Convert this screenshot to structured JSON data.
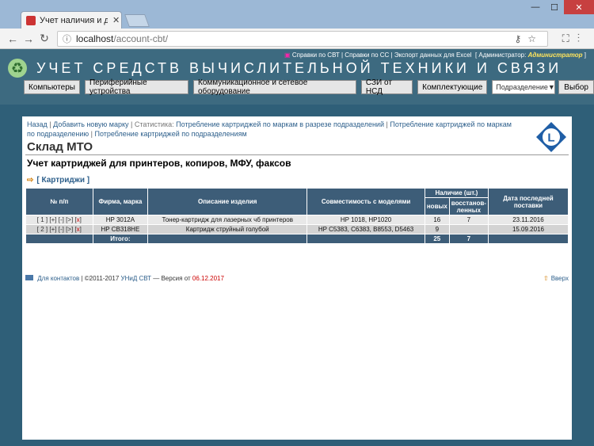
{
  "browser": {
    "tab_title": "Учет наличия и движен",
    "url_host": "localhost",
    "url_path": "/account-cbt/"
  },
  "header": {
    "links": [
      "Справки по СВТ",
      "Справки по СС",
      "Экспорт данных для Excel"
    ],
    "admin_label": "[ Администратор:",
    "admin_name": "Администратор",
    "admin_close": "]",
    "title": "УЧЕТ СРЕДСТВ ВЫЧИСЛИТЕЛЬНОЙ ТЕХНИКИ И СВЯЗИ"
  },
  "menu": {
    "items": [
      "Компьютеры",
      "Периферийные устройства",
      "Коммуникационное и сетевое оборудование",
      "СЗИ от НСД",
      "Комплектующие"
    ],
    "select_value": "Подразделение",
    "select_button": "Выбор"
  },
  "breadcrumb": {
    "back": "Назад",
    "add": "Добавить новую марку",
    "stats_label": "Статистика:",
    "stat1": "Потребление картриджей по маркам в разрезе подразделений",
    "stat2": "Потребление картриджей по маркам по подразделению",
    "stat3": "Потребление картриджей по подразделениям"
  },
  "page": {
    "title": "Склад МТО",
    "subtitle": "Учет картриджей для принтеров, копиров, МФУ, факсов",
    "section_link": "[ Картриджи ]"
  },
  "table": {
    "headers": {
      "num": "№ п/п",
      "brand": "Фирма, марка",
      "desc": "Описание изделия",
      "compat": "Совместимость с моделями",
      "stock": "Наличие (шт.)",
      "new": "новых",
      "restored": "восстанов-ленных",
      "date": "Дата последней поставки"
    },
    "rows": [
      {
        "actions": "[ 1 ] [+] [-] [>] [x]",
        "num": "1",
        "brand": "HP 3012A",
        "desc": "Тонер-картридж для лазерных чб принтеров",
        "compat": "HP 1018, HP1020",
        "new": "16",
        "restored": "7",
        "date": "23.11.2016"
      },
      {
        "actions": "[ 2 ] [+] [-] [>] [x]",
        "num": "2",
        "brand": "HP CB318HE",
        "desc": "Картридж струйный голубой",
        "compat": "HP C5383, C6383, B8553, D5463",
        "new": "9",
        "restored": "",
        "date": "15.09.2016"
      }
    ],
    "total_label": "Итого:",
    "total_new": "25",
    "total_restored": "7"
  },
  "footer": {
    "contacts": "Для контактов",
    "copy": "| ©2011-2017",
    "org": "УНиД СВТ",
    "version_label": "— Версия от",
    "version_date": "06.12.2017",
    "up": "Вверх"
  },
  "colors": {
    "header_bg": "#3d6a80",
    "table_head": "#3d5d78",
    "link": "#2d5f8b",
    "admin": "#ffe55c"
  }
}
